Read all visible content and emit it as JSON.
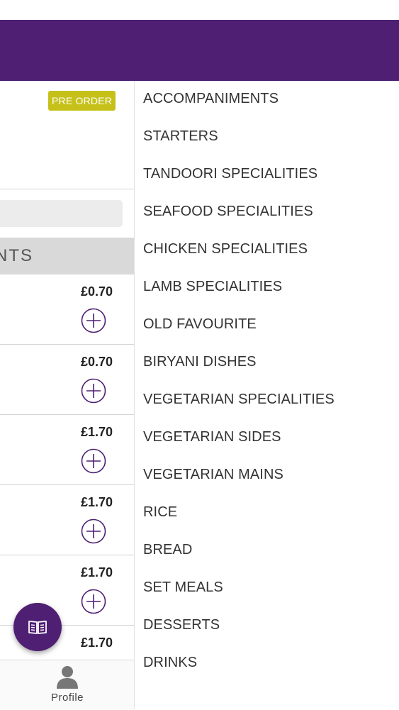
{
  "left_panel": {
    "badge": "PRE ORDER",
    "section_title_fragment": "NTS",
    "items": [
      {
        "price": "£0.70"
      },
      {
        "price": "£0.70"
      },
      {
        "price": "£1.70"
      },
      {
        "price": "£1.70"
      },
      {
        "price": "£1.70"
      },
      {
        "price": "£1.70"
      }
    ]
  },
  "fab": {
    "icon": "menu-book-icon"
  },
  "bottom_nav": {
    "profile_label": "Profile"
  },
  "categories": [
    "ACCOMPANIMENTS",
    "STARTERS",
    "TANDOORI SPECIALITIES",
    "SEAFOOD SPECIALITIES",
    "CHICKEN SPECIALITIES",
    "LAMB SPECIALITIES",
    "OLD FAVOURITE",
    "BIRYANI DISHES",
    "VEGETARIAN SPECIALITIES",
    "VEGETARIAN SIDES",
    "VEGETARIAN MAINS",
    "RICE",
    "BREAD",
    "SET MEALS",
    "DESSERTS",
    "DRINKS"
  ],
  "colors": {
    "header": "#4f1f73",
    "badge": "#c5c119",
    "accent": "#4f1f73"
  }
}
